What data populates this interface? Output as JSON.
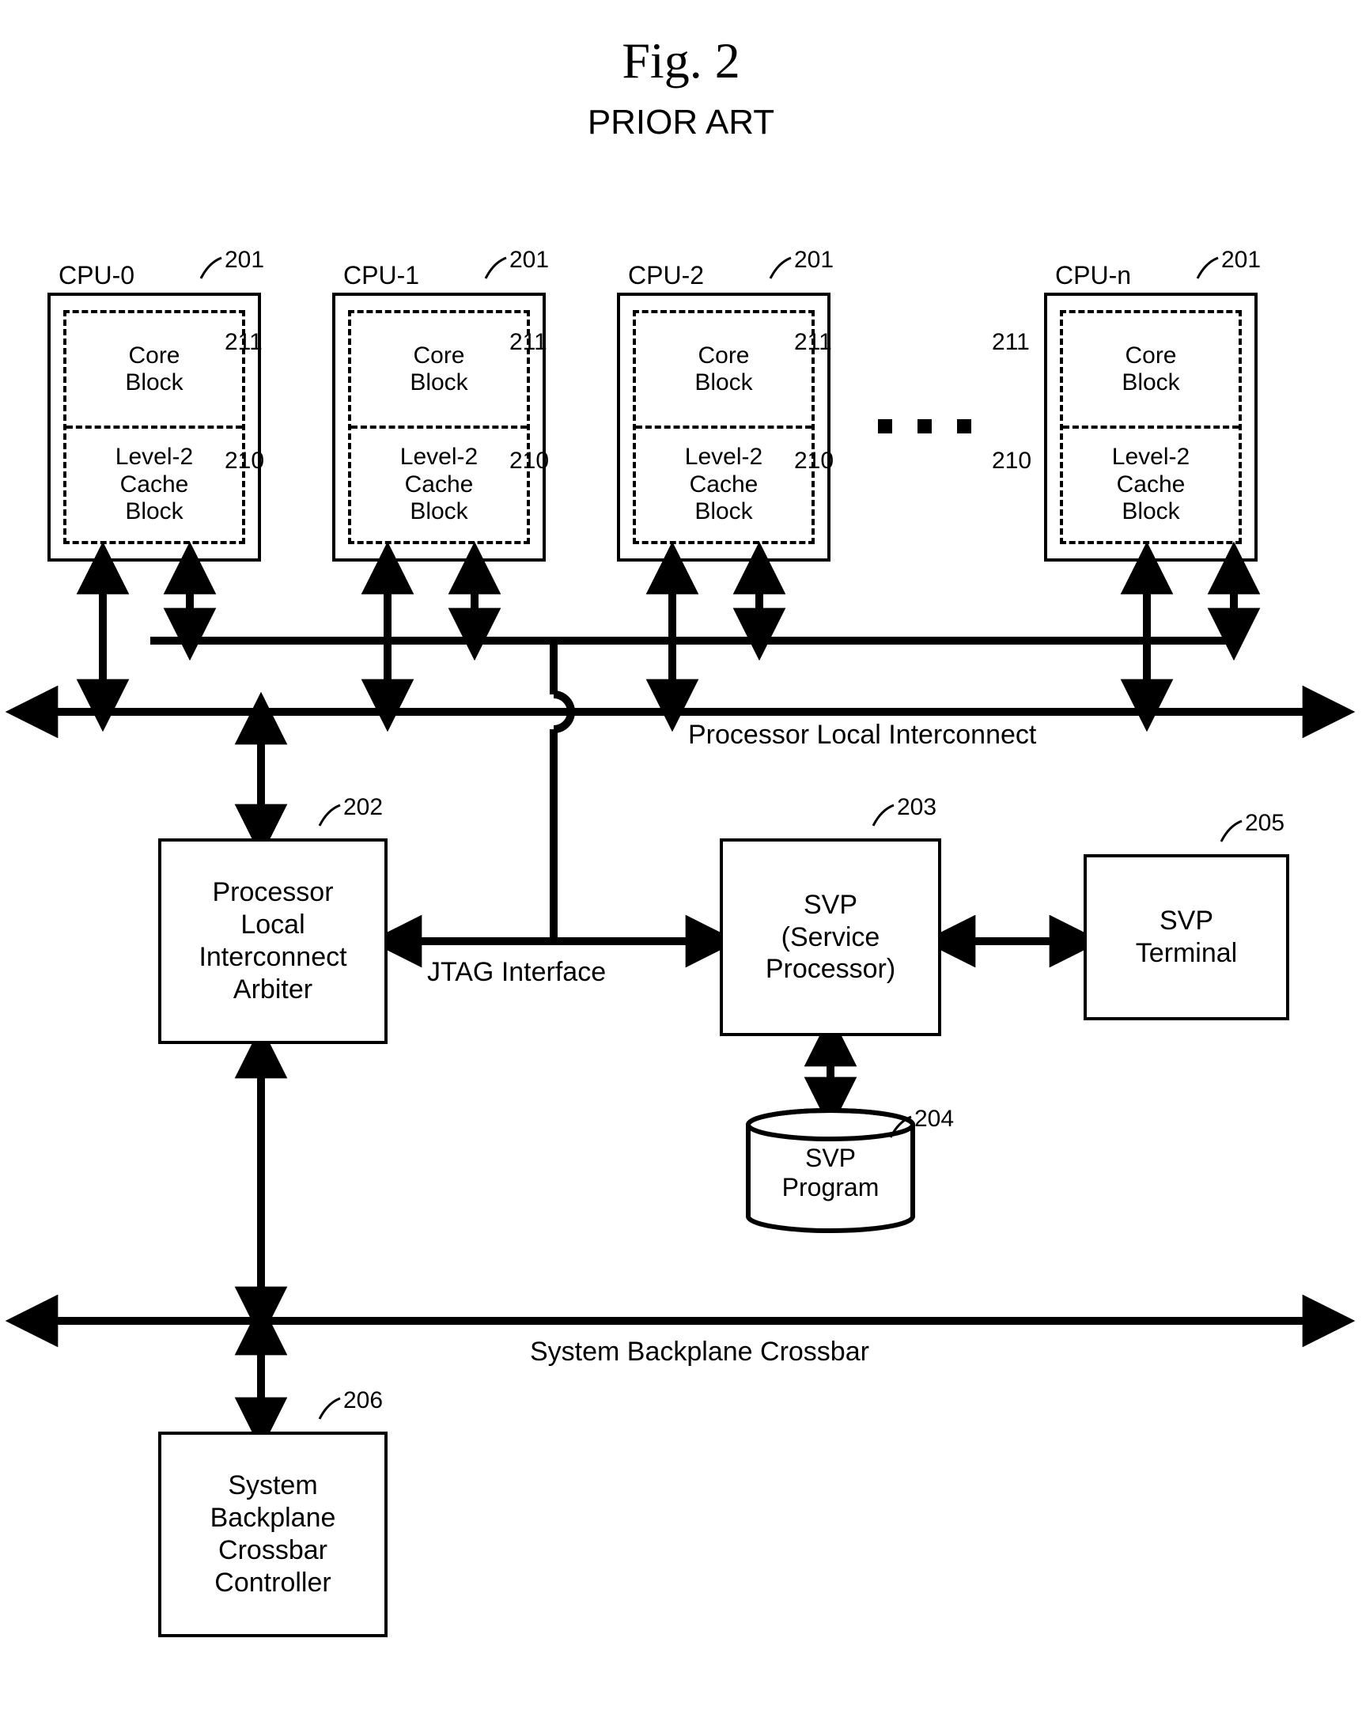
{
  "figure": {
    "title": "Fig. 2",
    "subtitle": "PRIOR ART"
  },
  "cpus": [
    {
      "name": "CPU-0",
      "ref": "201",
      "core": "Core\nBlock",
      "coreRef": "211",
      "cache": "Level-2\nCache\nBlock",
      "cacheRef": "210"
    },
    {
      "name": "CPU-1",
      "ref": "201",
      "core": "Core\nBlock",
      "coreRef": "211",
      "cache": "Level-2\nCache\nBlock",
      "cacheRef": "210"
    },
    {
      "name": "CPU-2",
      "ref": "201",
      "core": "Core\nBlock",
      "coreRef": "211",
      "cache": "Level-2\nCache\nBlock",
      "cacheRef": "210"
    },
    {
      "name": "CPU-n",
      "ref": "201",
      "core": "Core\nBlock",
      "coreRef": "211",
      "cache": "Level-2\nCache\nBlock",
      "cacheRef": "210"
    }
  ],
  "blocks": {
    "arbiter": {
      "label": "Processor\nLocal\nInterconnect\nArbiter",
      "ref": "202"
    },
    "svp": {
      "label": "SVP\n(Service\nProcessor)",
      "ref": "203"
    },
    "svpProg": {
      "label": "SVP\nProgram",
      "ref": "204"
    },
    "svpTerm": {
      "label": "SVP\nTerminal",
      "ref": "205"
    },
    "controller": {
      "label": "System\nBackplane\nCrossbar\nController",
      "ref": "206"
    }
  },
  "labels": {
    "jtag": "JTAG Interface",
    "localInterconnect": "Processor Local Interconnect",
    "backplane": "System Backplane Crossbar"
  }
}
